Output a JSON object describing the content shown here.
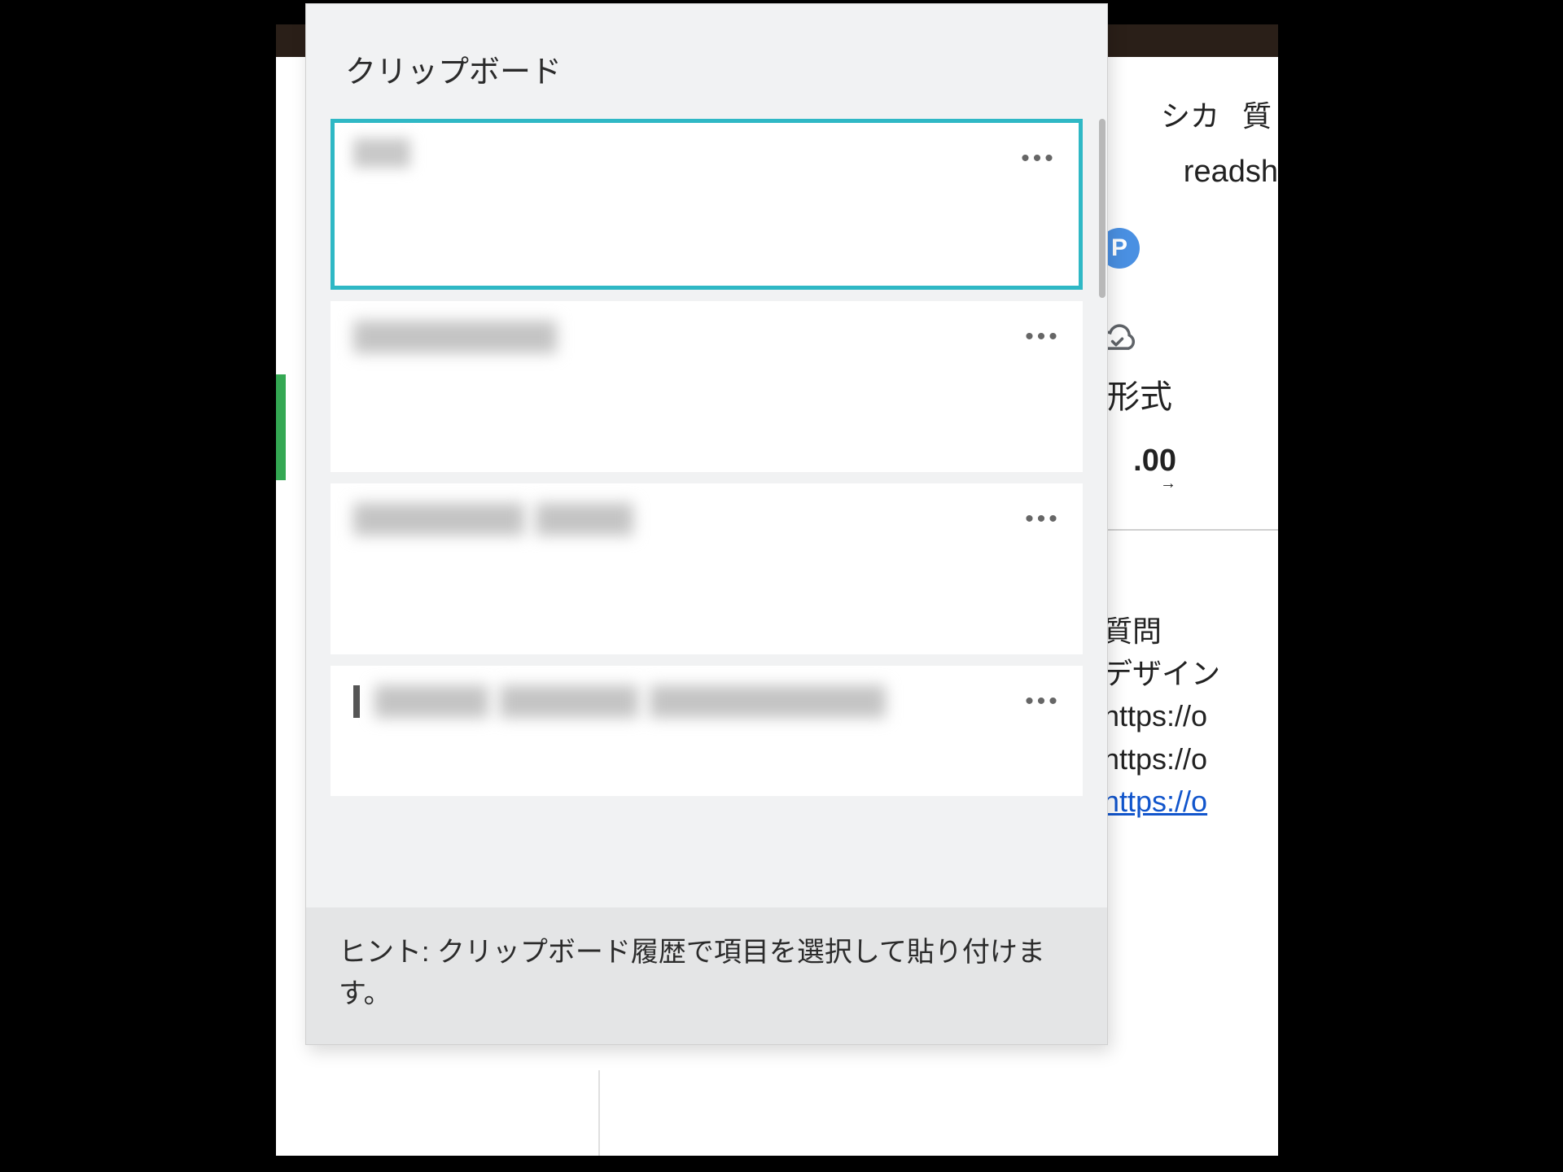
{
  "clipboard": {
    "title": "クリップボード",
    "hint": "ヒント: クリップボード履歴で項目を選択して貼り付けます。",
    "items": [
      {
        "selected": true
      },
      {
        "selected": false
      },
      {
        "selected": false
      },
      {
        "selected": false
      }
    ],
    "more_glyph": "•••"
  },
  "background": {
    "menu_fragments": [
      "シカ",
      "質"
    ],
    "address_fragment": "readsh",
    "p_badge": "P",
    "format_label": "形式",
    "decimal_button": ".00",
    "text_lines": {
      "question": "質問",
      "design": "デザイン",
      "url1": "https://o",
      "url2": "https://o",
      "url3_link": "https://o"
    }
  }
}
